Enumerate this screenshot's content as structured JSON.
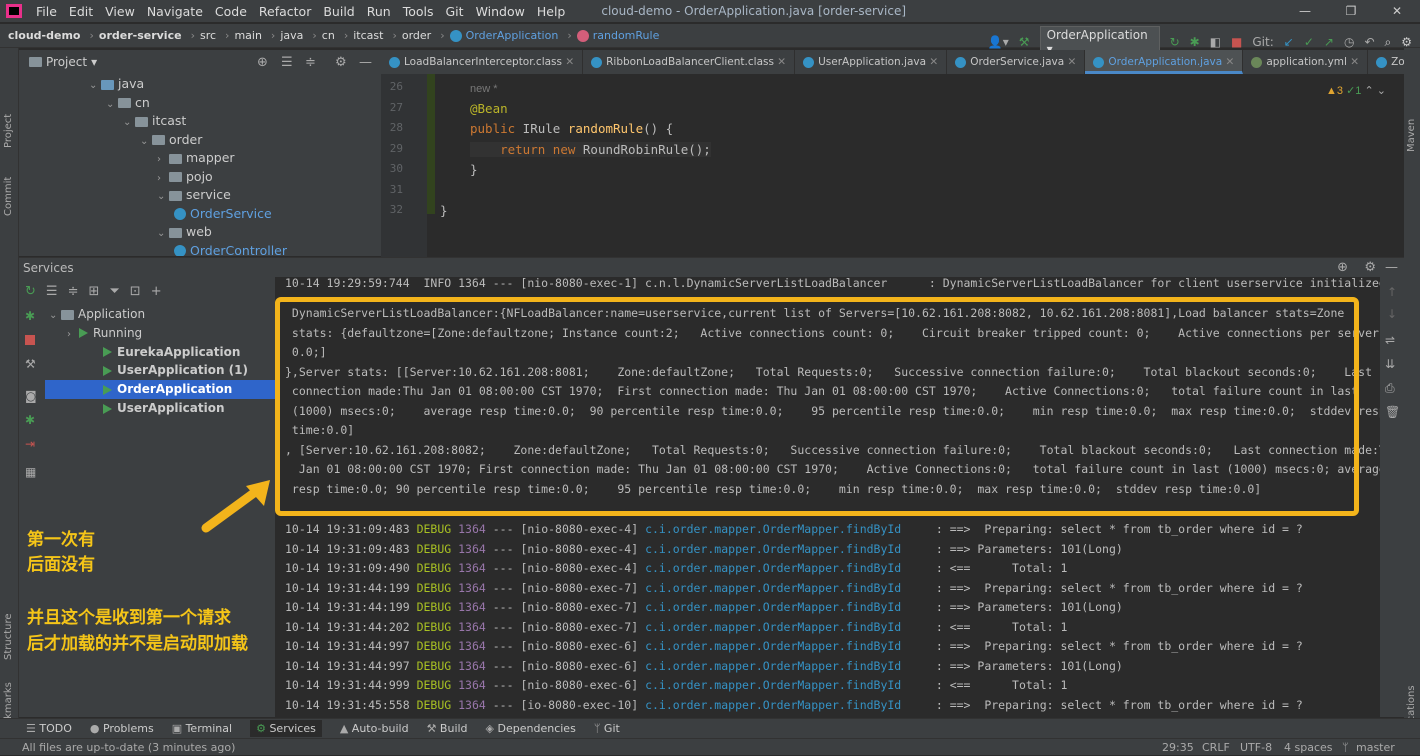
{
  "window": {
    "menu": [
      "File",
      "Edit",
      "View",
      "Navigate",
      "Code",
      "Refactor",
      "Build",
      "Run",
      "Tools",
      "Git",
      "Window",
      "Help"
    ],
    "title": "cloud-demo - OrderApplication.java [order-service]",
    "controls": [
      "—",
      "❐",
      "✕"
    ]
  },
  "breadcrumb": [
    "cloud-demo",
    "order-service",
    "src",
    "main",
    "java",
    "cn",
    "itcast",
    "order",
    "OrderApplication",
    "randomRule"
  ],
  "run_config": "OrderApplication",
  "git_label": "Git:",
  "project_panel": {
    "title": "Project",
    "tree": [
      {
        "label": "java",
        "indent": 0,
        "type": "folder-blue",
        "open": true
      },
      {
        "label": "cn",
        "indent": 1,
        "type": "folder",
        "open": true
      },
      {
        "label": "itcast",
        "indent": 2,
        "type": "folder",
        "open": true
      },
      {
        "label": "order",
        "indent": 3,
        "type": "folder",
        "open": true
      },
      {
        "label": "mapper",
        "indent": 4,
        "type": "folder",
        "open": false
      },
      {
        "label": "pojo",
        "indent": 4,
        "type": "folder",
        "open": false
      },
      {
        "label": "service",
        "indent": 4,
        "type": "folder",
        "open": true
      },
      {
        "label": "OrderService",
        "indent": 5,
        "type": "class"
      },
      {
        "label": "web",
        "indent": 4,
        "type": "folder",
        "open": true
      },
      {
        "label": "OrderController",
        "indent": 5,
        "type": "class"
      }
    ]
  },
  "editor_tabs": [
    "LoadBalancerInterceptor.class",
    "RibbonLoadBalancerClient.class",
    "UserApplication.java",
    "OrderService.java",
    "OrderApplication.java",
    "application.yml",
    "ZoneAware"
  ],
  "active_tab_index": 4,
  "inspection": {
    "warnings": "▲3",
    "ok": "✓1"
  },
  "code_lines": [
    {
      "num": "26",
      "text": "new *"
    },
    {
      "num": "27",
      "text": "@Bean"
    },
    {
      "num": "28",
      "text": "public IRule randomRule() {"
    },
    {
      "num": "29",
      "text": "    return new RoundRobinRule();"
    },
    {
      "num": "30",
      "text": "}"
    },
    {
      "num": "31",
      "text": ""
    },
    {
      "num": "32",
      "text": "}"
    }
  ],
  "services_panel": {
    "title": "Services",
    "tree": [
      {
        "label": "Application",
        "indent": 0
      },
      {
        "label": "Running",
        "indent": 1
      },
      {
        "label": "EurekaApplication",
        "indent": 2,
        "bold": true
      },
      {
        "label": "UserApplication (1)",
        "indent": 2,
        "bold": true
      },
      {
        "label": "OrderApplication",
        "indent": 2,
        "bold": true,
        "selected": true
      },
      {
        "label": "UserApplication",
        "indent": 2,
        "bold": true
      }
    ]
  },
  "annotation": {
    "line1": "第一次有",
    "line2": "后面没有",
    "line3": "并且这个是收到第一个请求",
    "line4": "后才加载的并不是启动即加载"
  },
  "console_header": [
    "10-14 19:29:59:744  INFO 1364 --- [nio-8080-exec-1] c.n.l.DynamicServerListLoadBalancer      : DynamicServerListLoadBalancer for client userservice initialized:"
  ],
  "console_block": [
    " DynamicServerListLoadBalancer:{NFLoadBalancer:name=userservice,current list of Servers=[10.62.161.208:8082, 10.62.161.208:8081],Load balancer stats=Zone",
    " stats: {defaultzone=[Zone:defaultzone; Instance count:2;   Active connections count: 0;    Circuit breaker tripped count: 0;    Active connections per server:",
    " 0.0;]",
    "},Server stats: [[Server:10.62.161.208:8081;    Zone:defaultZone;   Total Requests:0;   Successive connection failure:0;    Total blackout seconds:0;    Last",
    " connection made:Thu Jan 01 08:00:00 CST 1970;  First connection made: Thu Jan 01 08:00:00 CST 1970;    Active Connections:0;   total failure count in last",
    " (1000) msecs:0;    average resp time:0.0;  90 percentile resp time:0.0;    95 percentile resp time:0.0;    min resp time:0.0;  max resp time:0.0;  stddev resp",
    " time:0.0]",
    ", [Server:10.62.161.208:8082;    Zone:defaultZone;   Total Requests:0;   Successive connection failure:0;    Total blackout seconds:0;   Last connection made:Th",
    "  Jan 01 08:00:00 CST 1970; First connection made: Thu Jan 01 08:00:00 CST 1970;    Active Connections:0;   total failure count in last (1000) msecs:0; average",
    " resp time:0.0; 90 percentile resp time:0.0;    95 percentile resp time:0.0;    min resp time:0.0;  max resp time:0.0;  stddev resp time:0.0]"
  ],
  "debug_lines": [
    {
      "time": "10-14 19:31:09:483",
      "thread": "[nio-8080-exec-4]",
      "msg": ": ==>  Preparing: select * from tb_order where id = ?"
    },
    {
      "time": "10-14 19:31:09:483",
      "thread": "[nio-8080-exec-4]",
      "msg": ": ==> Parameters: 101(Long)"
    },
    {
      "time": "10-14 19:31:09:490",
      "thread": "[nio-8080-exec-4]",
      "msg": ": <==      Total: 1"
    },
    {
      "time": "10-14 19:31:44:199",
      "thread": "[nio-8080-exec-7]",
      "msg": ": ==>  Preparing: select * from tb_order where id = ?"
    },
    {
      "time": "10-14 19:31:44:199",
      "thread": "[nio-8080-exec-7]",
      "msg": ": ==> Parameters: 101(Long)"
    },
    {
      "time": "10-14 19:31:44:202",
      "thread": "[nio-8080-exec-7]",
      "msg": ": <==      Total: 1"
    },
    {
      "time": "10-14 19:31:44:997",
      "thread": "[nio-8080-exec-6]",
      "msg": ": ==>  Preparing: select * from tb_order where id = ?"
    },
    {
      "time": "10-14 19:31:44:997",
      "thread": "[nio-8080-exec-6]",
      "msg": ": ==> Parameters: 101(Long)"
    },
    {
      "time": "10-14 19:31:44:999",
      "thread": "[nio-8080-exec-6]",
      "msg": ": <==      Total: 1"
    },
    {
      "time": "10-14 19:31:45:558",
      "thread": "[io-8080-exec-10]",
      "msg": ": ==>  Preparing: select * from tb_order where id = ?"
    }
  ],
  "debug_common": {
    "level": "DEBUG",
    "pid": "1364",
    "sep": "---",
    "logger": "c.i.order.mapper.OrderMapper.findById"
  },
  "bottom_tabs": [
    "TODO",
    "Problems",
    "Terminal",
    "Services",
    "Auto-build",
    "Build",
    "Dependencies",
    "Git"
  ],
  "active_bottom_tab": "Services",
  "status": {
    "left": "All files are up-to-date (3 minutes ago)",
    "position": "29:35",
    "line_sep": "CRLF",
    "encoding": "UTF-8",
    "indent": "4 spaces",
    "branch": "master"
  },
  "side_labels": {
    "project": "Project",
    "commit": "Commit",
    "structure": "Structure",
    "bookmarks": "Bookmarks",
    "maven": "Maven",
    "notifications": "Notifications"
  },
  "colors": {
    "accent": "#f3b41b",
    "selection": "#2f65ca",
    "debug": "#a8c023"
  }
}
